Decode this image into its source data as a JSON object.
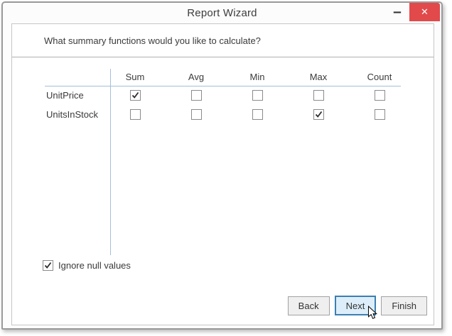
{
  "titlebar": {
    "title": "Report Wizard",
    "minimize_icon": "–",
    "close_icon": "✕"
  },
  "wizard": {
    "question": "What summary functions would you like to calculate?",
    "table": {
      "columns": [
        "Sum",
        "Avg",
        "Min",
        "Max",
        "Count"
      ],
      "rows": [
        {
          "field": "UnitPrice",
          "checked": [
            true,
            false,
            false,
            false,
            false
          ]
        },
        {
          "field": "UnitsInStock",
          "checked": [
            false,
            false,
            false,
            true,
            false
          ]
        }
      ]
    },
    "ignore_null": {
      "label": "Ignore null values",
      "checked": true
    }
  },
  "footer": {
    "buttons": [
      {
        "label": "Back",
        "focused": false
      },
      {
        "label": "Next",
        "focused": true
      },
      {
        "label": "Finish",
        "focused": false
      }
    ]
  },
  "colors": {
    "close_button_bg": "#e2494b",
    "focus_border": "#3c7fb1",
    "focus_fill": "#ddeefa",
    "grid_line": "#a4c0da",
    "check_mark": "#2b2b2b"
  }
}
